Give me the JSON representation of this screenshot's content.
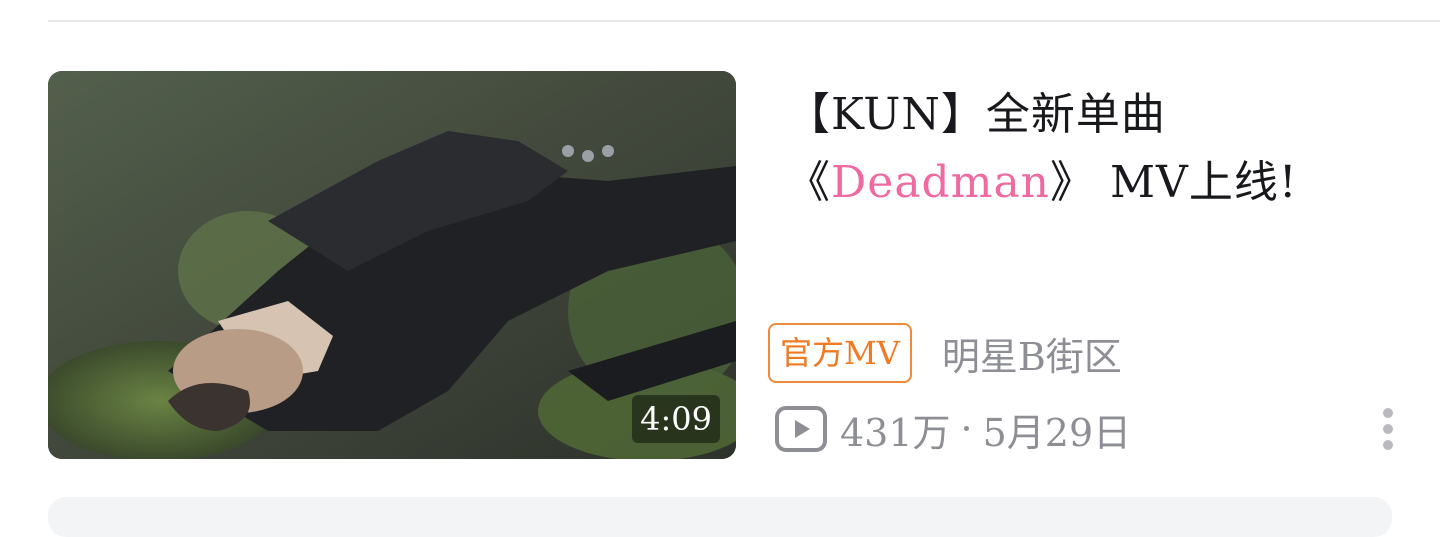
{
  "video": {
    "duration": "4:09",
    "title_prefix": "【KUN】全新单曲《",
    "title_highlight": "Deadman",
    "title_suffix": "》 MV上线!",
    "tag": "官方MV",
    "uploader": "明星B街区",
    "views": "431万",
    "separator": "·",
    "date": "5月29日"
  },
  "colors": {
    "highlight": "#ee6aa0",
    "tag": "#ef7a22",
    "meta": "#8d8f95"
  },
  "icons": {
    "views": "play-count-icon",
    "menu": "more-vertical-icon"
  }
}
